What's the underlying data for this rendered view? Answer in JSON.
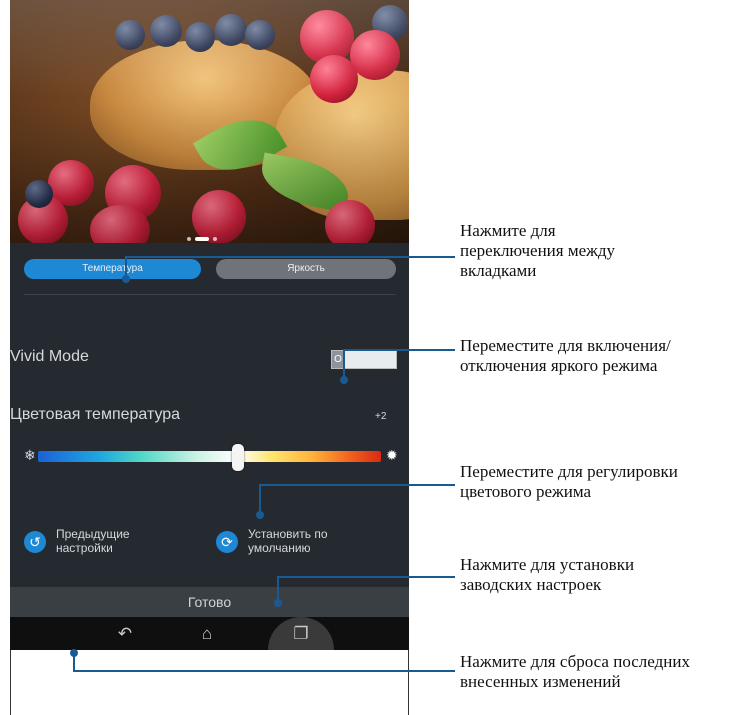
{
  "tabs": {
    "temperature": "Температура",
    "brightness": "Яркость"
  },
  "vivid_mode": {
    "label": "Vivid Mode",
    "toggle_state": "O"
  },
  "color_temperature": {
    "label": "Цветовая температура",
    "value": "+2",
    "position_percent": 58
  },
  "actions": {
    "previous": "Предыдущие\nнастройки",
    "default": "Установить по\nумолчанию",
    "done": "Готово"
  },
  "photo_pager": {
    "page_count": 3,
    "active_index": 1
  },
  "icons": {
    "cold": "snowflake-icon",
    "warm": "sun-icon",
    "previous": "undo-icon",
    "default": "reset-icon",
    "back": "back-icon",
    "home": "home-icon",
    "recent": "recent-apps-icon"
  },
  "colors": {
    "accent": "#1e88d4",
    "callout_line": "#1a5a92"
  },
  "callouts": [
    "Нажмите для\nпереключения между\nвкладками",
    "Переместите для включения/\nотключения яркого режима",
    "Переместите для регулировки\nцветового режима",
    "Нажмите для установки\nзаводских настроек",
    "Нажмите для сброса последних\nвнесенных изменений"
  ]
}
